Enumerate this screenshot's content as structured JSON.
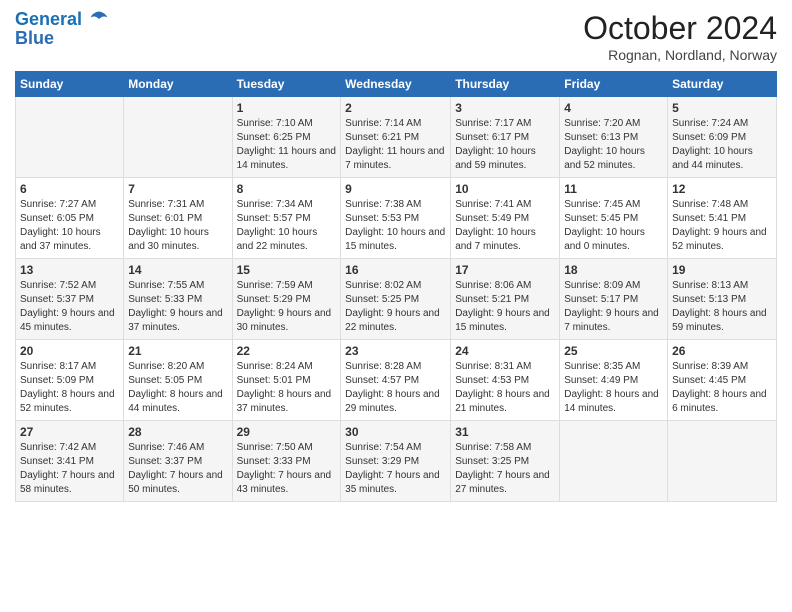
{
  "logo": {
    "line1": "General",
    "line2": "Blue"
  },
  "title": "October 2024",
  "subtitle": "Rognan, Nordland, Norway",
  "days_of_week": [
    "Sunday",
    "Monday",
    "Tuesday",
    "Wednesday",
    "Thursday",
    "Friday",
    "Saturday"
  ],
  "weeks": [
    [
      {
        "day": "",
        "info": ""
      },
      {
        "day": "",
        "info": ""
      },
      {
        "day": "1",
        "info": "Sunrise: 7:10 AM\nSunset: 6:25 PM\nDaylight: 11 hours and 14 minutes."
      },
      {
        "day": "2",
        "info": "Sunrise: 7:14 AM\nSunset: 6:21 PM\nDaylight: 11 hours and 7 minutes."
      },
      {
        "day": "3",
        "info": "Sunrise: 7:17 AM\nSunset: 6:17 PM\nDaylight: 10 hours and 59 minutes."
      },
      {
        "day": "4",
        "info": "Sunrise: 7:20 AM\nSunset: 6:13 PM\nDaylight: 10 hours and 52 minutes."
      },
      {
        "day": "5",
        "info": "Sunrise: 7:24 AM\nSunset: 6:09 PM\nDaylight: 10 hours and 44 minutes."
      }
    ],
    [
      {
        "day": "6",
        "info": "Sunrise: 7:27 AM\nSunset: 6:05 PM\nDaylight: 10 hours and 37 minutes."
      },
      {
        "day": "7",
        "info": "Sunrise: 7:31 AM\nSunset: 6:01 PM\nDaylight: 10 hours and 30 minutes."
      },
      {
        "day": "8",
        "info": "Sunrise: 7:34 AM\nSunset: 5:57 PM\nDaylight: 10 hours and 22 minutes."
      },
      {
        "day": "9",
        "info": "Sunrise: 7:38 AM\nSunset: 5:53 PM\nDaylight: 10 hours and 15 minutes."
      },
      {
        "day": "10",
        "info": "Sunrise: 7:41 AM\nSunset: 5:49 PM\nDaylight: 10 hours and 7 minutes."
      },
      {
        "day": "11",
        "info": "Sunrise: 7:45 AM\nSunset: 5:45 PM\nDaylight: 10 hours and 0 minutes."
      },
      {
        "day": "12",
        "info": "Sunrise: 7:48 AM\nSunset: 5:41 PM\nDaylight: 9 hours and 52 minutes."
      }
    ],
    [
      {
        "day": "13",
        "info": "Sunrise: 7:52 AM\nSunset: 5:37 PM\nDaylight: 9 hours and 45 minutes."
      },
      {
        "day": "14",
        "info": "Sunrise: 7:55 AM\nSunset: 5:33 PM\nDaylight: 9 hours and 37 minutes."
      },
      {
        "day": "15",
        "info": "Sunrise: 7:59 AM\nSunset: 5:29 PM\nDaylight: 9 hours and 30 minutes."
      },
      {
        "day": "16",
        "info": "Sunrise: 8:02 AM\nSunset: 5:25 PM\nDaylight: 9 hours and 22 minutes."
      },
      {
        "day": "17",
        "info": "Sunrise: 8:06 AM\nSunset: 5:21 PM\nDaylight: 9 hours and 15 minutes."
      },
      {
        "day": "18",
        "info": "Sunrise: 8:09 AM\nSunset: 5:17 PM\nDaylight: 9 hours and 7 minutes."
      },
      {
        "day": "19",
        "info": "Sunrise: 8:13 AM\nSunset: 5:13 PM\nDaylight: 8 hours and 59 minutes."
      }
    ],
    [
      {
        "day": "20",
        "info": "Sunrise: 8:17 AM\nSunset: 5:09 PM\nDaylight: 8 hours and 52 minutes."
      },
      {
        "day": "21",
        "info": "Sunrise: 8:20 AM\nSunset: 5:05 PM\nDaylight: 8 hours and 44 minutes."
      },
      {
        "day": "22",
        "info": "Sunrise: 8:24 AM\nSunset: 5:01 PM\nDaylight: 8 hours and 37 minutes."
      },
      {
        "day": "23",
        "info": "Sunrise: 8:28 AM\nSunset: 4:57 PM\nDaylight: 8 hours and 29 minutes."
      },
      {
        "day": "24",
        "info": "Sunrise: 8:31 AM\nSunset: 4:53 PM\nDaylight: 8 hours and 21 minutes."
      },
      {
        "day": "25",
        "info": "Sunrise: 8:35 AM\nSunset: 4:49 PM\nDaylight: 8 hours and 14 minutes."
      },
      {
        "day": "26",
        "info": "Sunrise: 8:39 AM\nSunset: 4:45 PM\nDaylight: 8 hours and 6 minutes."
      }
    ],
    [
      {
        "day": "27",
        "info": "Sunrise: 7:42 AM\nSunset: 3:41 PM\nDaylight: 7 hours and 58 minutes."
      },
      {
        "day": "28",
        "info": "Sunrise: 7:46 AM\nSunset: 3:37 PM\nDaylight: 7 hours and 50 minutes."
      },
      {
        "day": "29",
        "info": "Sunrise: 7:50 AM\nSunset: 3:33 PM\nDaylight: 7 hours and 43 minutes."
      },
      {
        "day": "30",
        "info": "Sunrise: 7:54 AM\nSunset: 3:29 PM\nDaylight: 7 hours and 35 minutes."
      },
      {
        "day": "31",
        "info": "Sunrise: 7:58 AM\nSunset: 3:25 PM\nDaylight: 7 hours and 27 minutes."
      },
      {
        "day": "",
        "info": ""
      },
      {
        "day": "",
        "info": ""
      }
    ]
  ]
}
